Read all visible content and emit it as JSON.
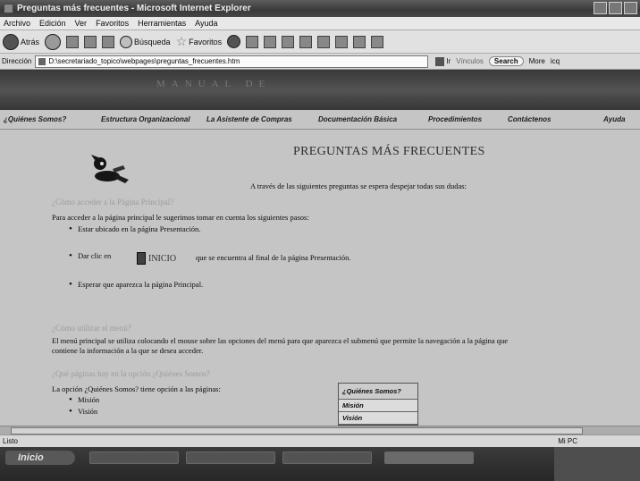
{
  "window": {
    "title": "Preguntas más frecuentes - Microsoft Internet Explorer"
  },
  "menubar": {
    "items": [
      "Archivo",
      "Edición",
      "Ver",
      "Favoritos",
      "Herramientas",
      "Ayuda"
    ]
  },
  "toolbar": {
    "back_label": "Atrás",
    "search_label": "Búsqueda",
    "favorites_label": "Favoritos"
  },
  "addressbar": {
    "label": "Dirección",
    "url": "D:\\secretariado_topico\\webpages\\preguntas_frecuentes.htm",
    "go_label": "Ir",
    "vinculos_label": "Vínculos",
    "search_label": "Search",
    "more_label": "More",
    "icq_label": "icq"
  },
  "banner": {
    "text": "MANUAL DE"
  },
  "nav": {
    "items": [
      "¿Quiénes Somos?",
      "Estructura Organizacional",
      "La Asistente de Compras",
      "Documentación Básica",
      "Procedimientos",
      "Contáctenos",
      "Ayuda"
    ]
  },
  "page": {
    "title": "PREGUNTAS MÁS FRECUENTES",
    "intro": "A través de las siguientes preguntas se espera despejar todas sus dudas:",
    "q1": {
      "heading": "¿Cómo acceder a la Página Principal?",
      "text": "Para acceder a la página principal le sugerimos tomar en cuenta los siguientes pasos:",
      "step1": "Estar ubicado en la página Presentación.",
      "step2_pre": "Dar clic en",
      "step2_post": "que se encuentra al final de la página Presentación.",
      "inicio_label": "INICIO",
      "step3": "Esperar que aparezca la página Principal."
    },
    "q2": {
      "heading": "¿Cómo utilizar el menú?",
      "text1": "El menú principal se utiliza colocando el mouse sobre las opciones del menú para que aparezca el submenú que permite la navegación a la página que",
      "text2": "contiene la información a la que se desea acceder."
    },
    "q3": {
      "heading": "¿Qué páginas hay en la opción ¿Quiénes Somos?",
      "text": "La opción ¿Quiénes Somos? tiene opción a las páginas:",
      "item1": "Misión",
      "item2": "Visión"
    },
    "submenu": {
      "head": "¿Quiénes Somos?",
      "items": [
        "Misión",
        "Visión"
      ]
    }
  },
  "statusbar": {
    "text": "Listo",
    "zone": "Mi PC"
  },
  "taskbar": {
    "start_label": "Inicio"
  }
}
